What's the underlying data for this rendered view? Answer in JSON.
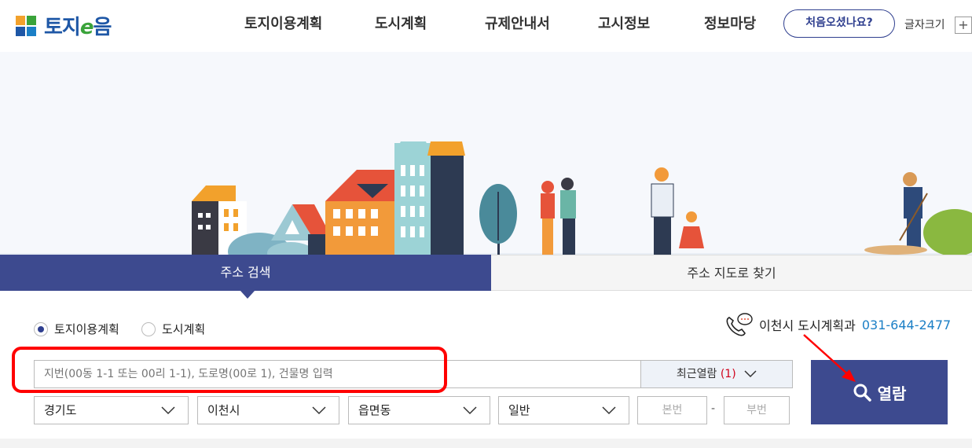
{
  "header": {
    "logo_text_a": "토지",
    "logo_text_e": "e",
    "logo_text_b": "음",
    "nav": [
      "토지이용계획",
      "도시계획",
      "규제안내서",
      "고시정보",
      "정보마당"
    ],
    "first_visit_label": "처음오셨나요?",
    "font_size_label": "글자크기",
    "font_plus": "+"
  },
  "tabs": {
    "address_search": "주소 검색",
    "map_search": "주소 지도로 찾기"
  },
  "search": {
    "radio_land": "토지이용계획",
    "radio_city": "도시계획",
    "contact_label": "이천시 도시계획과",
    "contact_phone": "031-644-2477",
    "placeholder": "지번(00동 1-1 또는 00리 1-1), 도로명(00로 1), 건물명 입력",
    "recent_label": "최근열람",
    "recent_count": "(1)",
    "province": "경기도",
    "city": "이천시",
    "town": "읍면동",
    "type": "일반",
    "main_num": "본번",
    "dash": "-",
    "sub_num": "부번",
    "open_label": "열람"
  },
  "colors": {
    "primary": "#3d4a8f",
    "phone": "#1b7fc6",
    "highlight": "#ff0000"
  }
}
